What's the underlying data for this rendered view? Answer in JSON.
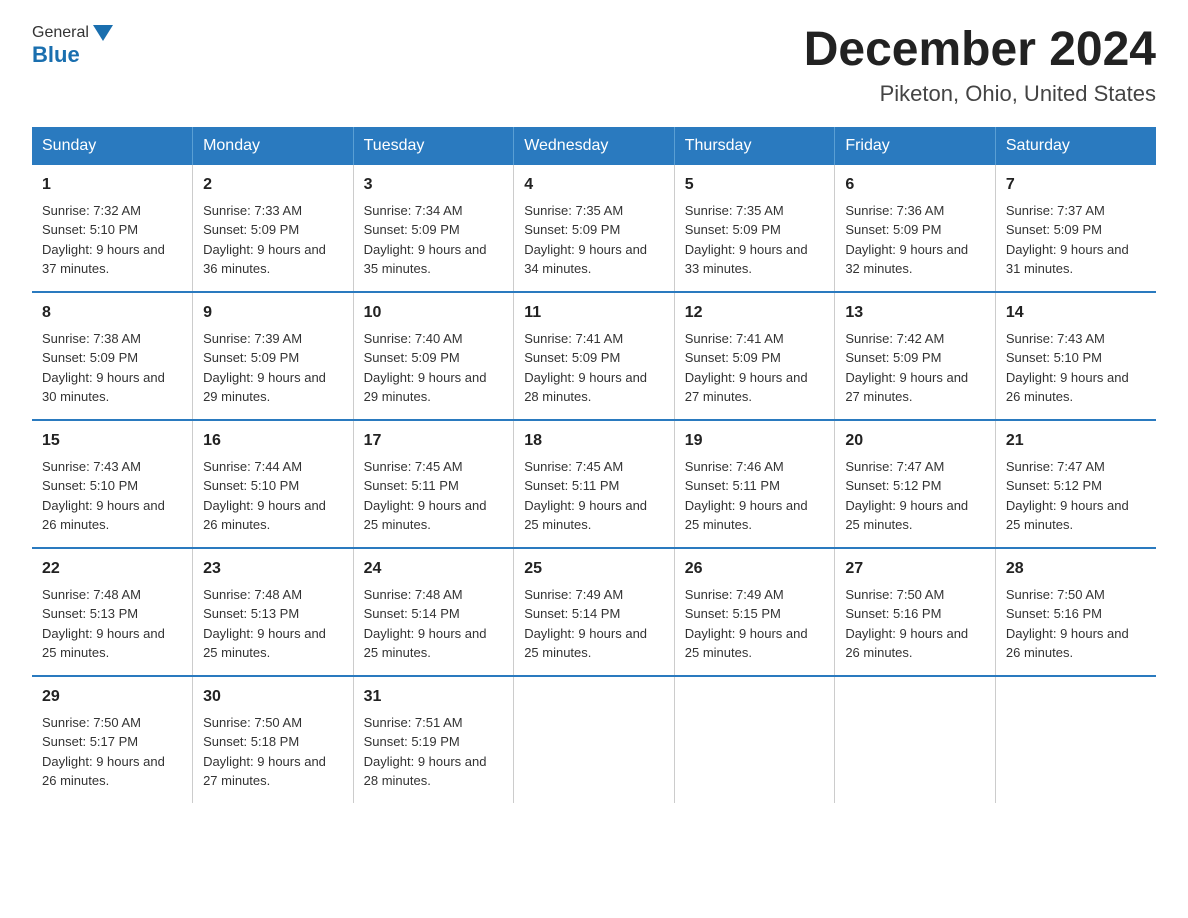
{
  "logo": {
    "general": "General",
    "blue": "Blue"
  },
  "title": "December 2024",
  "location": "Piketon, Ohio, United States",
  "days_of_week": [
    "Sunday",
    "Monday",
    "Tuesday",
    "Wednesday",
    "Thursday",
    "Friday",
    "Saturday"
  ],
  "weeks": [
    [
      {
        "day": "1",
        "sunrise": "Sunrise: 7:32 AM",
        "sunset": "Sunset: 5:10 PM",
        "daylight": "Daylight: 9 hours and 37 minutes."
      },
      {
        "day": "2",
        "sunrise": "Sunrise: 7:33 AM",
        "sunset": "Sunset: 5:09 PM",
        "daylight": "Daylight: 9 hours and 36 minutes."
      },
      {
        "day": "3",
        "sunrise": "Sunrise: 7:34 AM",
        "sunset": "Sunset: 5:09 PM",
        "daylight": "Daylight: 9 hours and 35 minutes."
      },
      {
        "day": "4",
        "sunrise": "Sunrise: 7:35 AM",
        "sunset": "Sunset: 5:09 PM",
        "daylight": "Daylight: 9 hours and 34 minutes."
      },
      {
        "day": "5",
        "sunrise": "Sunrise: 7:35 AM",
        "sunset": "Sunset: 5:09 PM",
        "daylight": "Daylight: 9 hours and 33 minutes."
      },
      {
        "day": "6",
        "sunrise": "Sunrise: 7:36 AM",
        "sunset": "Sunset: 5:09 PM",
        "daylight": "Daylight: 9 hours and 32 minutes."
      },
      {
        "day": "7",
        "sunrise": "Sunrise: 7:37 AM",
        "sunset": "Sunset: 5:09 PM",
        "daylight": "Daylight: 9 hours and 31 minutes."
      }
    ],
    [
      {
        "day": "8",
        "sunrise": "Sunrise: 7:38 AM",
        "sunset": "Sunset: 5:09 PM",
        "daylight": "Daylight: 9 hours and 30 minutes."
      },
      {
        "day": "9",
        "sunrise": "Sunrise: 7:39 AM",
        "sunset": "Sunset: 5:09 PM",
        "daylight": "Daylight: 9 hours and 29 minutes."
      },
      {
        "day": "10",
        "sunrise": "Sunrise: 7:40 AM",
        "sunset": "Sunset: 5:09 PM",
        "daylight": "Daylight: 9 hours and 29 minutes."
      },
      {
        "day": "11",
        "sunrise": "Sunrise: 7:41 AM",
        "sunset": "Sunset: 5:09 PM",
        "daylight": "Daylight: 9 hours and 28 minutes."
      },
      {
        "day": "12",
        "sunrise": "Sunrise: 7:41 AM",
        "sunset": "Sunset: 5:09 PM",
        "daylight": "Daylight: 9 hours and 27 minutes."
      },
      {
        "day": "13",
        "sunrise": "Sunrise: 7:42 AM",
        "sunset": "Sunset: 5:09 PM",
        "daylight": "Daylight: 9 hours and 27 minutes."
      },
      {
        "day": "14",
        "sunrise": "Sunrise: 7:43 AM",
        "sunset": "Sunset: 5:10 PM",
        "daylight": "Daylight: 9 hours and 26 minutes."
      }
    ],
    [
      {
        "day": "15",
        "sunrise": "Sunrise: 7:43 AM",
        "sunset": "Sunset: 5:10 PM",
        "daylight": "Daylight: 9 hours and 26 minutes."
      },
      {
        "day": "16",
        "sunrise": "Sunrise: 7:44 AM",
        "sunset": "Sunset: 5:10 PM",
        "daylight": "Daylight: 9 hours and 26 minutes."
      },
      {
        "day": "17",
        "sunrise": "Sunrise: 7:45 AM",
        "sunset": "Sunset: 5:11 PM",
        "daylight": "Daylight: 9 hours and 25 minutes."
      },
      {
        "day": "18",
        "sunrise": "Sunrise: 7:45 AM",
        "sunset": "Sunset: 5:11 PM",
        "daylight": "Daylight: 9 hours and 25 minutes."
      },
      {
        "day": "19",
        "sunrise": "Sunrise: 7:46 AM",
        "sunset": "Sunset: 5:11 PM",
        "daylight": "Daylight: 9 hours and 25 minutes."
      },
      {
        "day": "20",
        "sunrise": "Sunrise: 7:47 AM",
        "sunset": "Sunset: 5:12 PM",
        "daylight": "Daylight: 9 hours and 25 minutes."
      },
      {
        "day": "21",
        "sunrise": "Sunrise: 7:47 AM",
        "sunset": "Sunset: 5:12 PM",
        "daylight": "Daylight: 9 hours and 25 minutes."
      }
    ],
    [
      {
        "day": "22",
        "sunrise": "Sunrise: 7:48 AM",
        "sunset": "Sunset: 5:13 PM",
        "daylight": "Daylight: 9 hours and 25 minutes."
      },
      {
        "day": "23",
        "sunrise": "Sunrise: 7:48 AM",
        "sunset": "Sunset: 5:13 PM",
        "daylight": "Daylight: 9 hours and 25 minutes."
      },
      {
        "day": "24",
        "sunrise": "Sunrise: 7:48 AM",
        "sunset": "Sunset: 5:14 PM",
        "daylight": "Daylight: 9 hours and 25 minutes."
      },
      {
        "day": "25",
        "sunrise": "Sunrise: 7:49 AM",
        "sunset": "Sunset: 5:14 PM",
        "daylight": "Daylight: 9 hours and 25 minutes."
      },
      {
        "day": "26",
        "sunrise": "Sunrise: 7:49 AM",
        "sunset": "Sunset: 5:15 PM",
        "daylight": "Daylight: 9 hours and 25 minutes."
      },
      {
        "day": "27",
        "sunrise": "Sunrise: 7:50 AM",
        "sunset": "Sunset: 5:16 PM",
        "daylight": "Daylight: 9 hours and 26 minutes."
      },
      {
        "day": "28",
        "sunrise": "Sunrise: 7:50 AM",
        "sunset": "Sunset: 5:16 PM",
        "daylight": "Daylight: 9 hours and 26 minutes."
      }
    ],
    [
      {
        "day": "29",
        "sunrise": "Sunrise: 7:50 AM",
        "sunset": "Sunset: 5:17 PM",
        "daylight": "Daylight: 9 hours and 26 minutes."
      },
      {
        "day": "30",
        "sunrise": "Sunrise: 7:50 AM",
        "sunset": "Sunset: 5:18 PM",
        "daylight": "Daylight: 9 hours and 27 minutes."
      },
      {
        "day": "31",
        "sunrise": "Sunrise: 7:51 AM",
        "sunset": "Sunset: 5:19 PM",
        "daylight": "Daylight: 9 hours and 28 minutes."
      },
      {
        "day": "",
        "sunrise": "",
        "sunset": "",
        "daylight": ""
      },
      {
        "day": "",
        "sunrise": "",
        "sunset": "",
        "daylight": ""
      },
      {
        "day": "",
        "sunrise": "",
        "sunset": "",
        "daylight": ""
      },
      {
        "day": "",
        "sunrise": "",
        "sunset": "",
        "daylight": ""
      }
    ]
  ]
}
